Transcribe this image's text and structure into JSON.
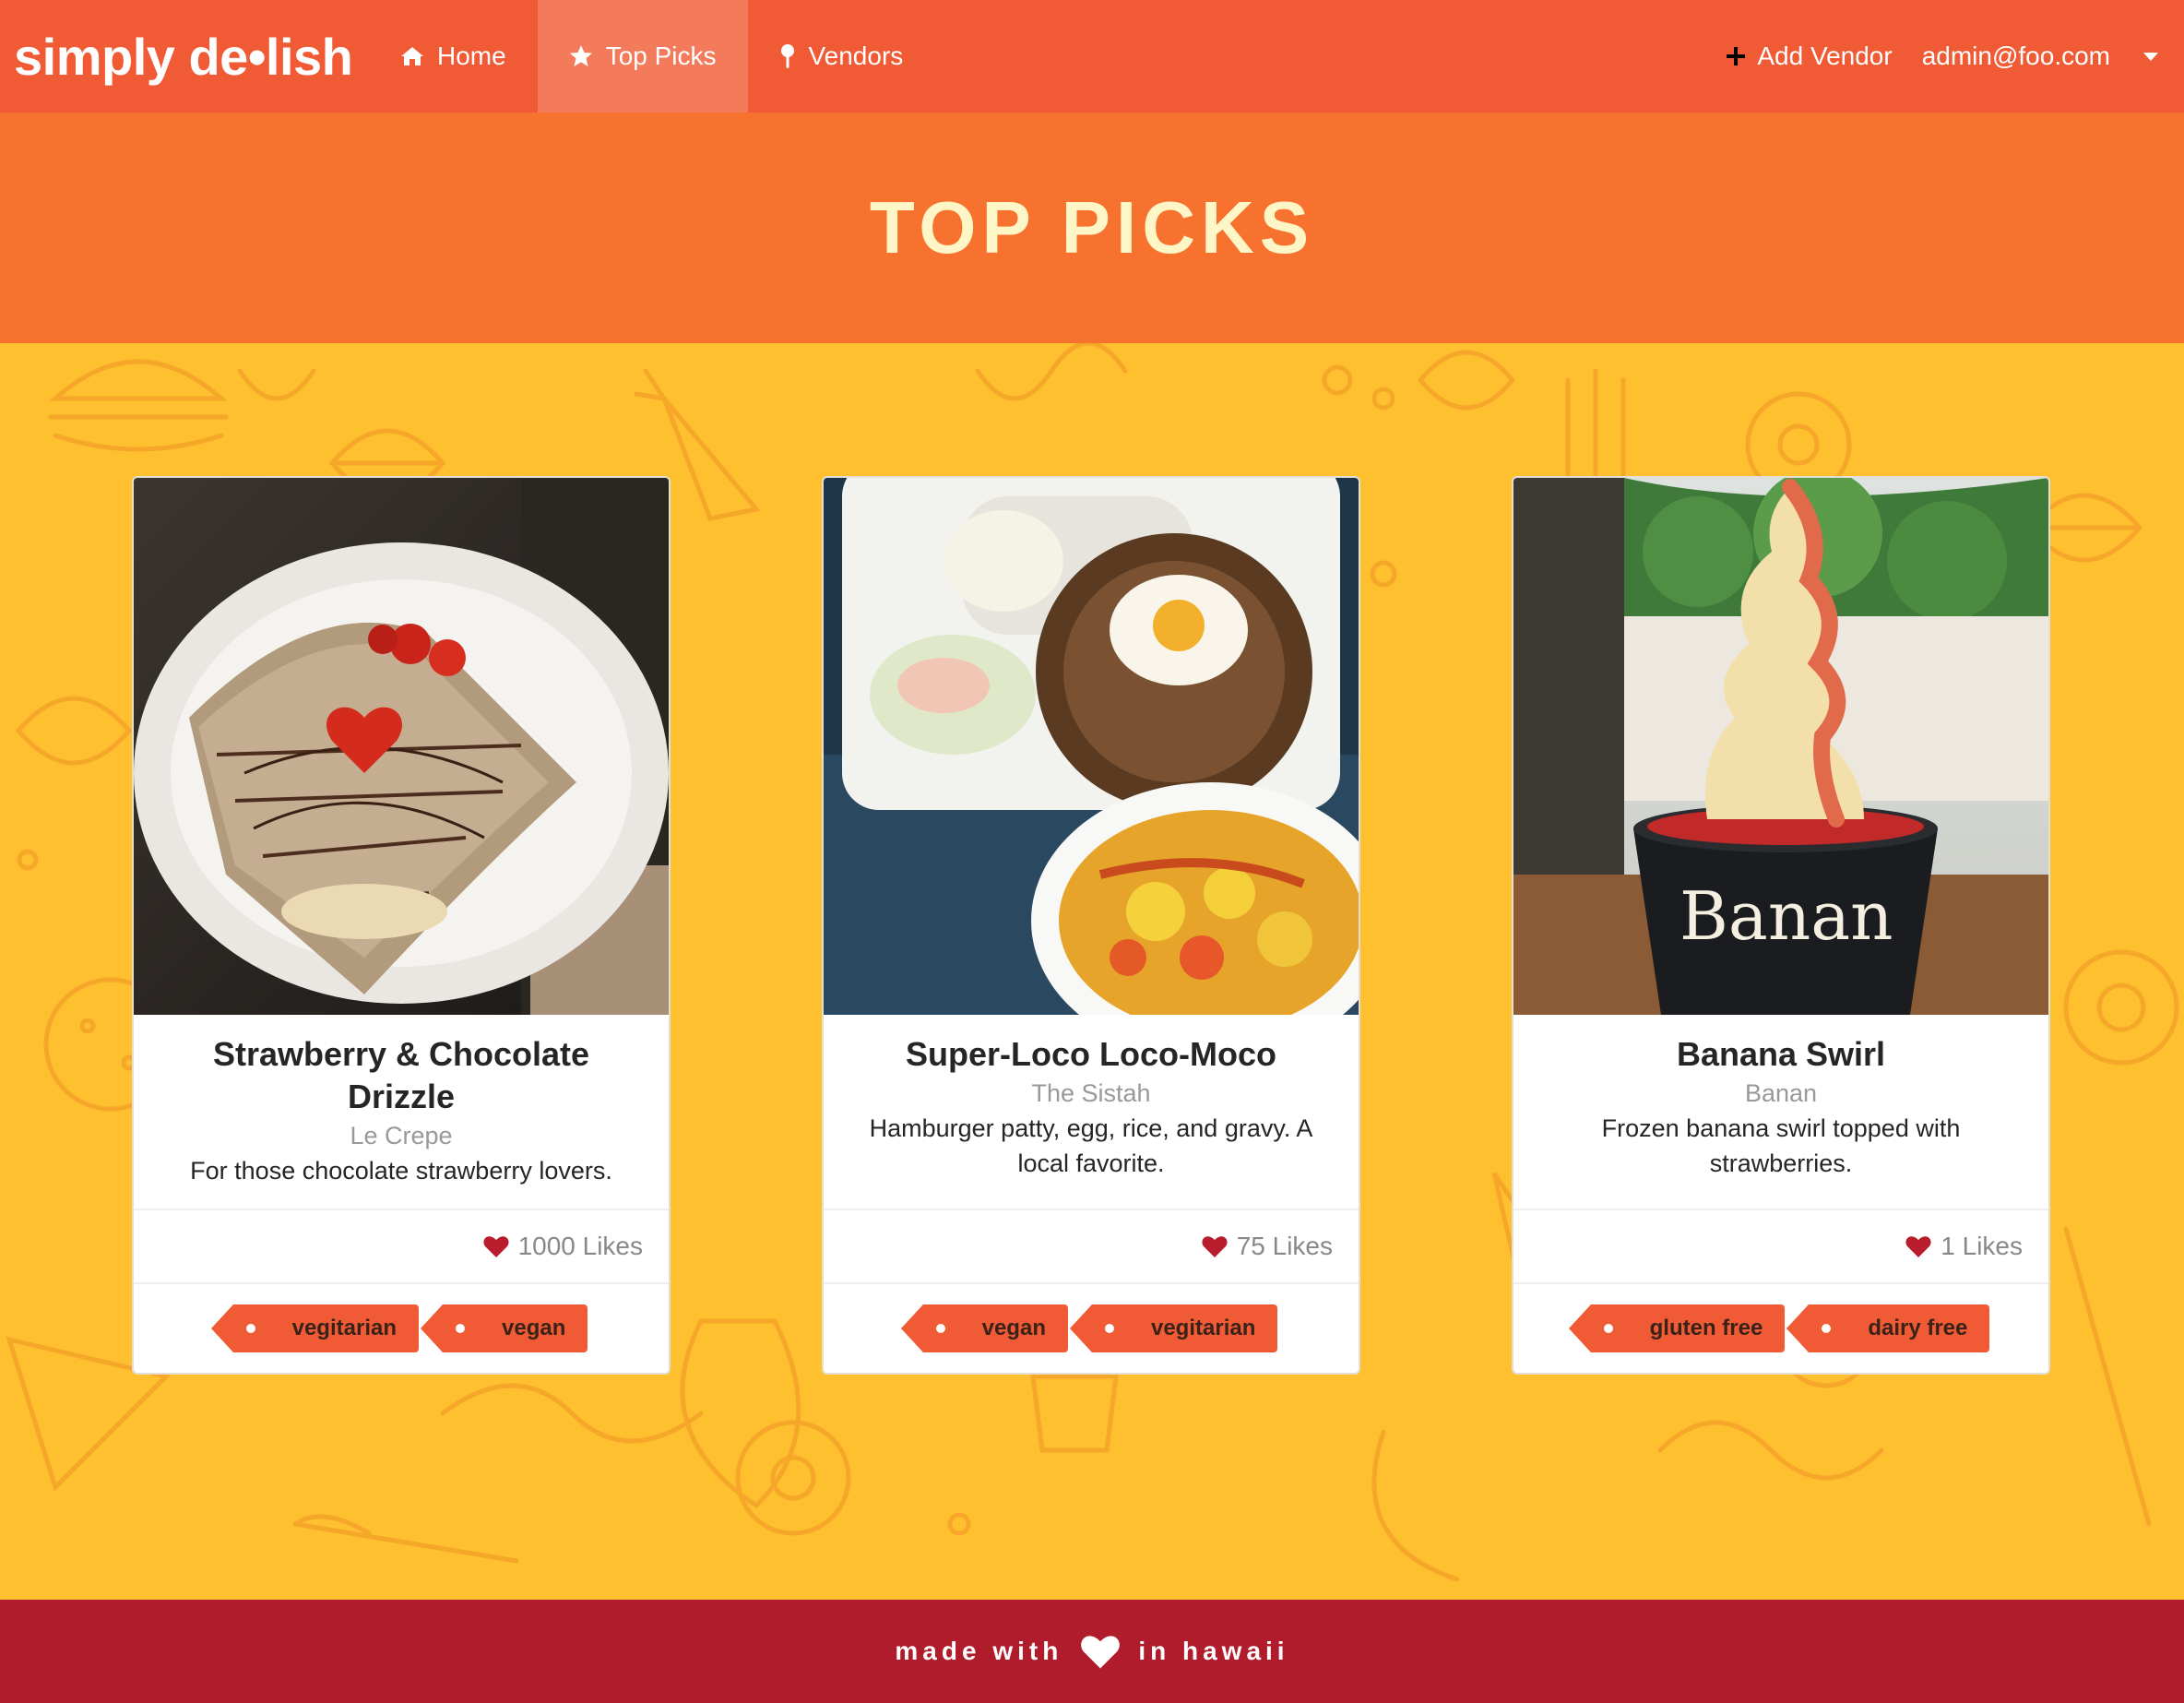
{
  "nav": {
    "brand": "simply de•lish",
    "items": [
      {
        "label": "Home",
        "icon": "home-icon"
      },
      {
        "label": "Top Picks",
        "icon": "star-icon",
        "active": true
      },
      {
        "label": "Vendors",
        "icon": "map-pin-icon"
      }
    ],
    "add_vendor": "Add Vendor",
    "user_email": "admin@foo.com"
  },
  "banner": {
    "title": "TOP PICKS"
  },
  "cards": [
    {
      "title": "Strawberry & Chocolate Drizzle",
      "vendor": "Le Crepe",
      "description": "For those chocolate strawberry lovers.",
      "likes": "1000 Likes",
      "tags": [
        "vegitarian",
        "vegan"
      ]
    },
    {
      "title": "Super-Loco Loco-Moco",
      "vendor": "The Sistah",
      "description": "Hamburger patty, egg, rice, and gravy. A local favorite.",
      "likes": "75 Likes",
      "tags": [
        "vegan",
        "vegitarian"
      ]
    },
    {
      "title": "Banana Swirl",
      "vendor": "Banan",
      "description": "Frozen banana swirl topped with strawberries.",
      "likes": "1 Likes",
      "tags": [
        "gluten free",
        "dairy free"
      ],
      "cup_text": "Banan"
    }
  ],
  "footer": {
    "before": "made with",
    "after": "in hawaii"
  },
  "colors": {
    "navbar": "#f05a35",
    "nav_active": "#f37a5b",
    "banner": "#f7712f",
    "banner_text": "#fff6c8",
    "background": "#fec02f",
    "tag": "#f05a35",
    "heart": "#b81c2d",
    "footer": "#b11c2c"
  }
}
